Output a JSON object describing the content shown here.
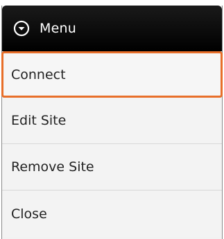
{
  "menu": {
    "title": "Menu",
    "title_icon": "chevron-down-circle-icon",
    "items": [
      {
        "label": "Connect",
        "focused": true
      },
      {
        "label": "Edit Site",
        "focused": false
      },
      {
        "label": "Remove Site",
        "focused": false
      },
      {
        "label": "Close",
        "focused": false
      }
    ]
  },
  "colors": {
    "header_bg": "#000000",
    "focus_border": "#e86f2a",
    "item_bg": "#f3f3f3",
    "item_text": "#222222"
  }
}
